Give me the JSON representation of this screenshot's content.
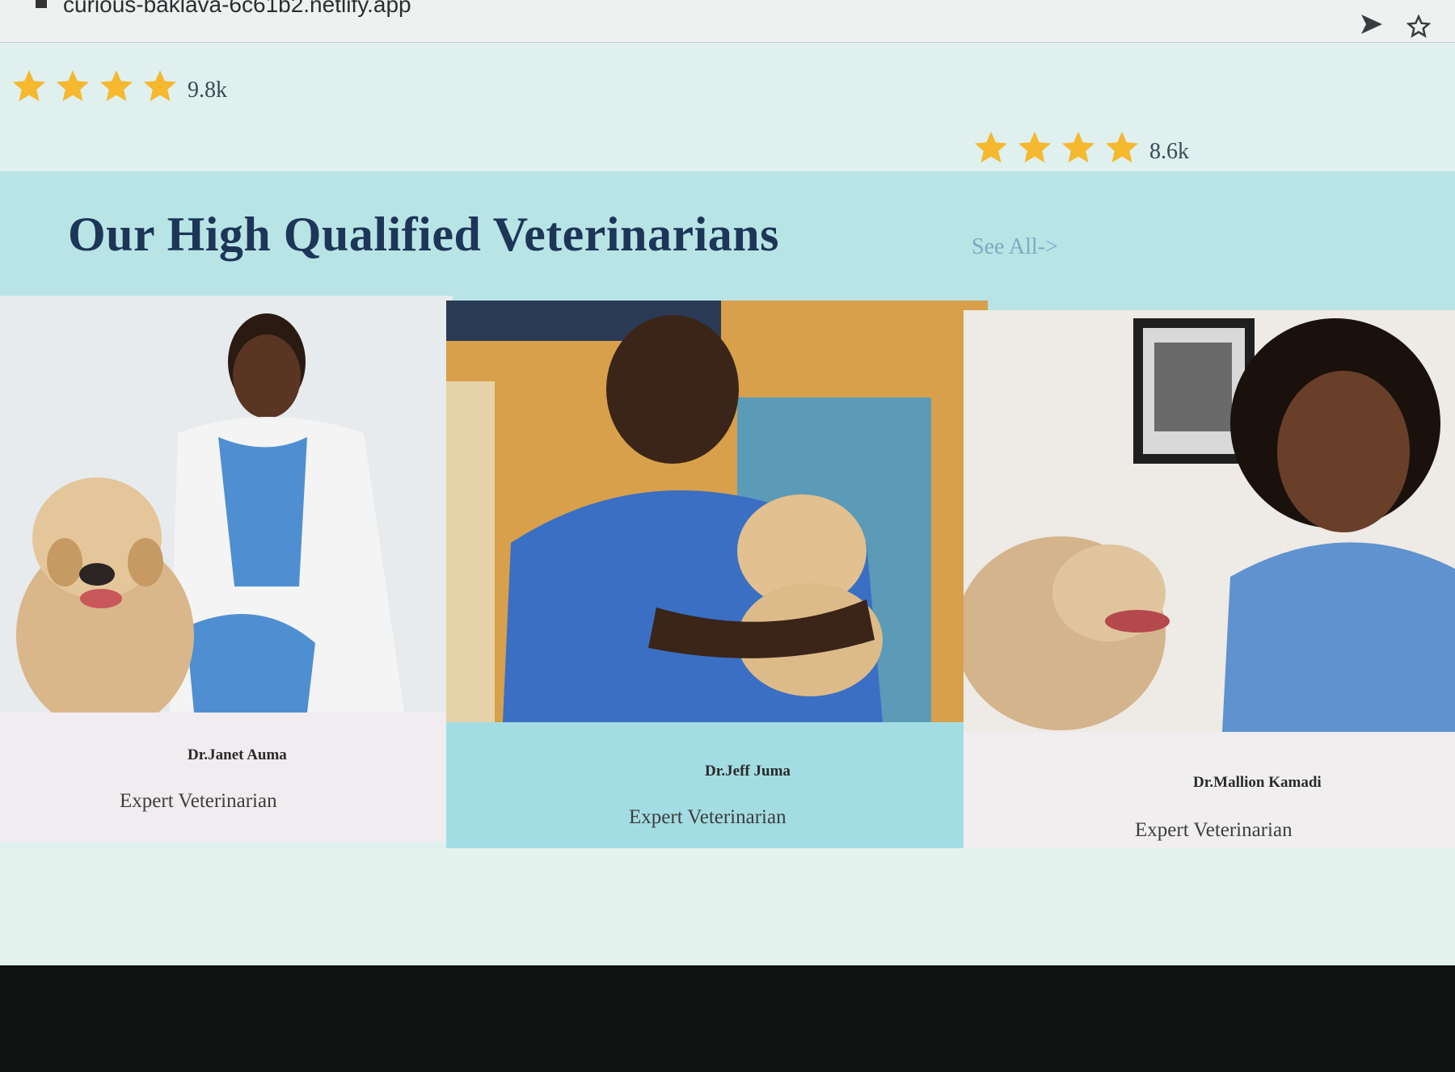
{
  "browser": {
    "url": "curious-baklava-6c61b2.netlify.app",
    "icons": [
      "send-icon",
      "bookmark-star-icon"
    ]
  },
  "ratings": [
    {
      "stars": 4,
      "count_label": "9.8k"
    },
    {
      "stars": 4,
      "count_label": "8.6k"
    }
  ],
  "section": {
    "title": "Our High Qualified Veterinarians",
    "see_all_label": "See All->"
  },
  "veterinarians": [
    {
      "name": "Dr.Janet Auma",
      "role": "Expert Veterinarian"
    },
    {
      "name": "Dr.Jeff Juma",
      "role": "Expert Veterinarian"
    },
    {
      "name": "Dr.Mallion Kamadi",
      "role": "Expert Veterinarian"
    }
  ],
  "colors": {
    "star": "#f5b82e",
    "title": "#1d3557",
    "see_all": "#7fa9c2",
    "section_band": "#b8e4e6",
    "highlight_card": "#a3dde3"
  }
}
